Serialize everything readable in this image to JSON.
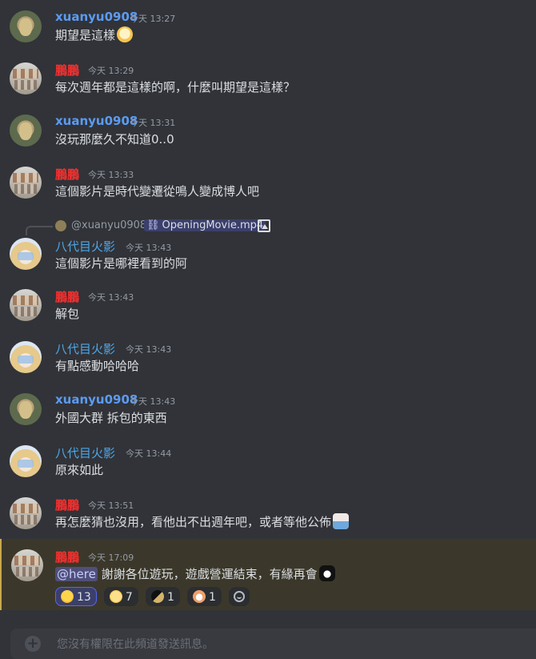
{
  "messages": [
    {
      "author": "xuanyu0908",
      "time": "今天 13:27",
      "text": "期望是這樣"
    },
    {
      "author": "鵬鵬",
      "time": "今天 13:29",
      "text": "每次週年都是這樣的啊，什麼叫期望是這樣？"
    },
    {
      "author": "xuanyu0908",
      "time": "今天 13:31",
      "text": "沒玩那麼久不知道0..0"
    },
    {
      "author": "鵬鵬",
      "time": "今天 13:33",
      "text": "這個影片是時代變遷從鳴人變成博人吧"
    },
    {
      "author": "八代目火影",
      "time": "今天 13:43",
      "text": "這個影片是哪裡看到的阿",
      "reply": {
        "user": "@xuanyu0908",
        "attachment": "OpeningMovie.mp4"
      }
    },
    {
      "author": "鵬鵬",
      "time": "今天 13:43",
      "text": "解包"
    },
    {
      "author": "八代目火影",
      "time": "今天 13:43",
      "text": "有點感動哈哈哈"
    },
    {
      "author": "xuanyu0908",
      "time": "今天 13:43",
      "text": "外國大群 拆包的東西"
    },
    {
      "author": "八代目火影",
      "time": "今天 13:44",
      "text": "原來如此"
    },
    {
      "author": "鵬鵬",
      "time": "今天 13:51",
      "text": "再怎麼猜也沒用，看他出不出週年吧，或者等他公佈"
    },
    {
      "author": "鵬鵬",
      "time": "今天 17:09",
      "mention": "@here",
      "text": " 謝謝各位遊玩，遊戲營運結束，有緣再會"
    }
  ],
  "reactions": [
    {
      "count": "13",
      "emoji": "sad-cat-emoji"
    },
    {
      "count": "7",
      "emoji": "crying-face-emoji"
    },
    {
      "count": "1",
      "emoji": "anime-emoji-1"
    },
    {
      "count": "1",
      "emoji": "anime-emoji-2"
    }
  ],
  "composer": {
    "placeholder": "您沒有權限在此頻道發送訊息。"
  },
  "colors": {
    "background": "#313338",
    "xuanyu": "#5b9bf3",
    "peng": "#f2302e",
    "yakumo": "#4fa6e8",
    "highlight_bg": "#3b382b"
  }
}
